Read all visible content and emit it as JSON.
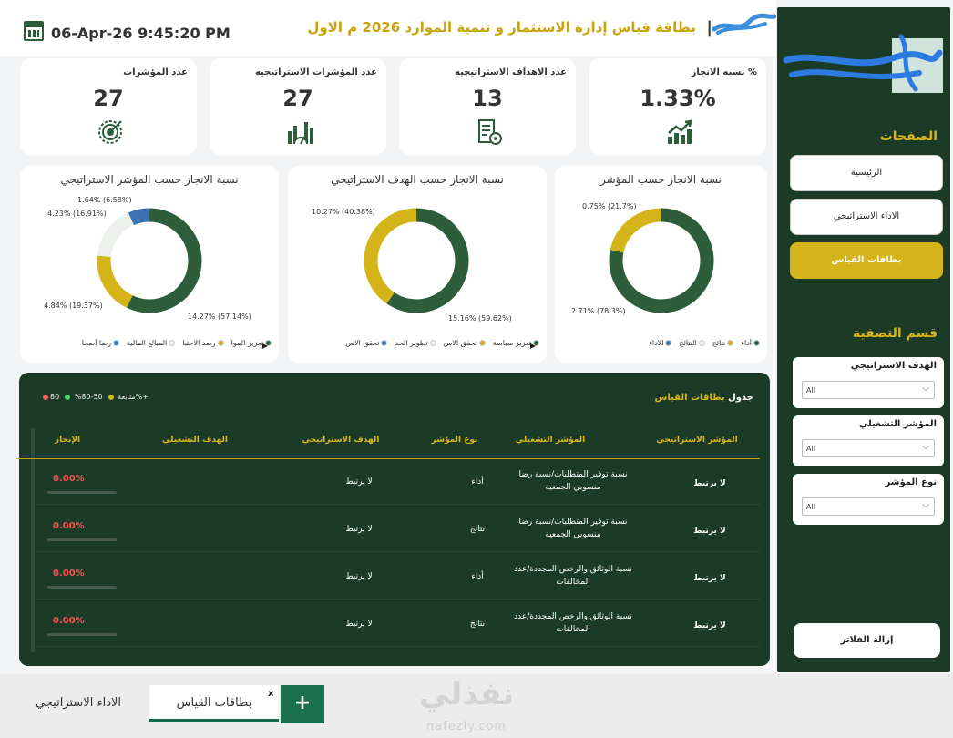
{
  "header": {
    "datetime": "06-Apr-26 9:45:20 PM",
    "title": "بطاقة قياس إدارة الاستثمار و تنمية الموارد 2026 م الاول",
    "separator": "|"
  },
  "kpis": [
    {
      "label": "% نسبه الانجاز",
      "value": "1.33%",
      "icon": "growth-chart-icon"
    },
    {
      "label": "عدد الاهداف الاستراتيجيه",
      "value": "13",
      "icon": "checklist-target-icon"
    },
    {
      "label": "عدد المؤشرات الاستراتيجيه",
      "value": "27",
      "icon": "gauge-bars-icon"
    },
    {
      "label": "عدد المؤشرات",
      "value": "27",
      "icon": "target-icon"
    }
  ],
  "colors": {
    "green": "#2d5d3a",
    "gold": "#d4b418",
    "light": "#eef0ee",
    "blue": "#3a74b4",
    "panel": "#1c3b26",
    "red": "#ff4d4d"
  },
  "chart_data": [
    {
      "type": "pie",
      "title": "نسبة الانجاز حسب المؤشر الاستراتيجي",
      "slices": [
        {
          "label": "14.27% (57.14%)",
          "value": 57.14,
          "color": "#2d5d3a"
        },
        {
          "label": "4.84% (19.37%)",
          "value": 19.37,
          "color": "#d4b418"
        },
        {
          "label": "4.23% (16.91%)",
          "value": 16.91,
          "color": "#eef0ee"
        },
        {
          "label": "1.64% (6.58%)",
          "value": 6.58,
          "color": "#3a74b4"
        }
      ],
      "legend": [
        "تعزيز الموا",
        "رصد الاحتيا",
        "المبالغ المالية",
        "رضا أصحا"
      ]
    },
    {
      "type": "pie",
      "title": "نسبة الانجاز حسب الهدف الاستراتيجي",
      "slices": [
        {
          "label": "15.16% (59.62%)",
          "value": 59.62,
          "color": "#2d5d3a"
        },
        {
          "label": "10.27% (40.38%)",
          "value": 40.38,
          "color": "#d4b418"
        }
      ],
      "legend": [
        "تعزيز سياسة",
        "تحقق الاس",
        "تطوير الحد",
        "تحقق الاس"
      ]
    },
    {
      "type": "pie",
      "title": "نسبة الانجاز حسب المؤشر",
      "slices": [
        {
          "label": "2.71% (78.3%)",
          "value": 78.3,
          "color": "#2d5d3a"
        },
        {
          "label": "0.75% (21.7%)",
          "value": 21.7,
          "color": "#d4b418"
        }
      ],
      "legend": [
        "أداء",
        "نتائج",
        "النتائج",
        "الاداء"
      ]
    }
  ],
  "table": {
    "title_prefix": "جدول",
    "title": "بطاقات القياس",
    "legend": [
      "80%+",
      "50-80%",
      "متابعة"
    ],
    "headers": [
      "المؤشر الاستراتيجي",
      "المؤشر التشغيلي",
      "نوع المؤشر",
      "الهدف الاستراتيجي",
      "الهدف التشغيلي",
      "الإنجاز"
    ],
    "rows": [
      {
        "strategic": "لا يرتبط",
        "operational": "نسبة توفير المتطلبات/نسبة رضا منسوبي الجمعية",
        "type": "أداء",
        "goal": "لا يرتبط",
        "op_goal": "",
        "achievement": "0.00%"
      },
      {
        "strategic": "لا يرتبط",
        "operational": "نسبة توفير المتطلبات/نسبة رضا منسوبي الجمعية",
        "type": "نتائج",
        "goal": "لا يرتبط",
        "op_goal": "",
        "achievement": "0.00%"
      },
      {
        "strategic": "لا يرتبط",
        "operational": "نسبة الوثائق والرخص المجددة/عدد المخالفات",
        "type": "أداء",
        "goal": "لا يرتبط",
        "op_goal": "",
        "achievement": "0.00%"
      },
      {
        "strategic": "لا يرتبط",
        "operational": "نسبة الوثائق والرخص المجددة/عدد المخالفات",
        "type": "نتائج",
        "goal": "لا يرتبط",
        "op_goal": "",
        "achievement": "0.00%"
      }
    ]
  },
  "sidebar": {
    "pages_heading": "الصفحات",
    "nav": [
      "الرئيسية",
      "الاداء الاستراتيجي",
      "بطاقات القياس"
    ],
    "filters_heading": "قسم التصفية",
    "filters": [
      {
        "label": "الهدف الاستراتيجي",
        "value": "All"
      },
      {
        "label": "المؤشر التشغيلي",
        "value": "All"
      },
      {
        "label": "نوع المؤشر",
        "value": "All"
      }
    ],
    "clear_button": "إزالة الفلاتر"
  },
  "tabs": {
    "items": [
      "الاداء الاستراتيجي",
      "بطاقات القياس"
    ],
    "close": "x",
    "add": "+"
  },
  "watermark": {
    "text": "نفذلي",
    "sub": "nafezly.com"
  }
}
